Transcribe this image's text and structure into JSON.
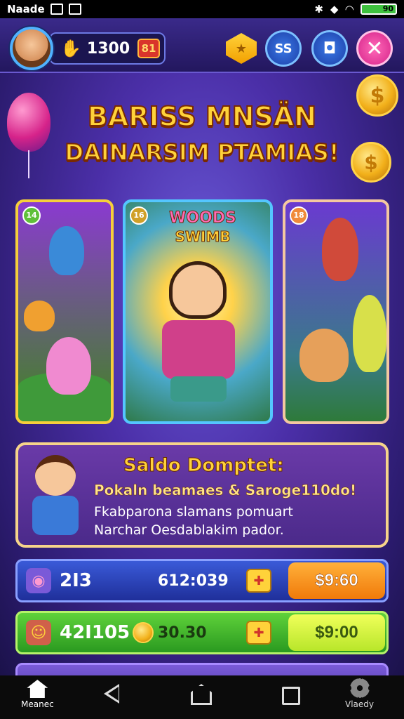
{
  "status_bar": {
    "carrier": "Naade",
    "battery_text": "90"
  },
  "top_bar": {
    "coins": "1300",
    "badge": "81",
    "ss_label": "SS"
  },
  "title": {
    "line1": "BARISS MNSÄN",
    "line2": "DAINARSIM PTAMIAS!"
  },
  "cards": [
    {
      "number": "14"
    },
    {
      "number": "16",
      "logo_line1": "WOODS",
      "logo_line2": "SWIMB"
    },
    {
      "number": "18"
    }
  ],
  "wallet": {
    "title": "Saldo Domptet:",
    "subtitle": "Pokaln beamaes & Saroge110do!",
    "line1": "Fkabparona slamans pomuart",
    "line2": "Narchar Oesdablakim pador."
  },
  "offers": [
    {
      "value": "2I3",
      "mid": "612:039",
      "price": "$9:60"
    },
    {
      "value": "42I105",
      "mid": "30.30",
      "price": "$9:00"
    },
    {
      "value": "",
      "mid": "",
      "price": ""
    }
  ],
  "nav": {
    "home_label": "Meanec",
    "settings_label": "Vlaedy"
  },
  "colors": {
    "accent_gold": "#ffd23a",
    "offer_blue": "#3a5ad8",
    "offer_green": "#5fd23a",
    "close_pink": "#d6238a"
  }
}
